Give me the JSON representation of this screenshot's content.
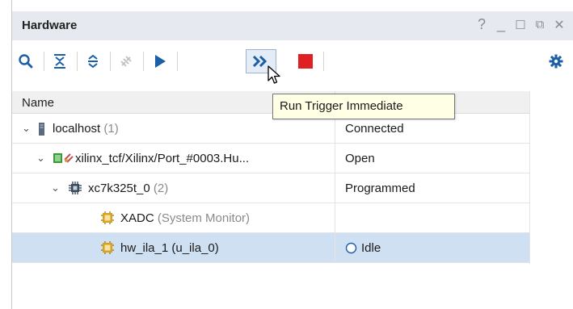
{
  "window": {
    "title": "Hardware",
    "controls": {
      "help": "?",
      "minimize": "_",
      "maximize": "☐",
      "restore": "⧉",
      "close": "✕"
    }
  },
  "toolbar": {
    "buttons": [
      {
        "icon": "search-icon"
      },
      {
        "icon": "collapse-all-icon"
      },
      {
        "icon": "expand-all-icon"
      },
      {
        "icon": "auto-connect-icon"
      },
      {
        "icon": "run-trigger-icon"
      },
      {
        "icon": "run-trigger-immediate-icon"
      },
      {
        "icon": "stop-trigger-icon"
      },
      {
        "icon": "gear-icon"
      }
    ],
    "tooltip": "Run Trigger Immediate"
  },
  "table": {
    "headers": {
      "name": "Name"
    },
    "rows": [
      {
        "label": "localhost",
        "suffix": "(1)",
        "status": "Connected",
        "icon": "server-icon"
      },
      {
        "label": "xilinx_tcf/Xilinx/Port_#0003.Hu...",
        "suffix": "",
        "status": "Open",
        "icon": "jtag-cable-icon"
      },
      {
        "label": "xc7k325t_0",
        "suffix": "(2)",
        "status": "Programmed",
        "icon": "fpga-chip-icon"
      },
      {
        "label": "XADC",
        "suffix": "(System Monitor)",
        "status": "",
        "icon": "xadc-core-icon"
      },
      {
        "label": "hw_ila_1 (u_ila_0)",
        "suffix": "",
        "status": "Idle",
        "icon": "ila-core-icon"
      }
    ]
  },
  "colors": {
    "titlebar": "#e6eaf0",
    "selected_row": "#cfe0f3",
    "run_blue": "#1a5fa8",
    "stop_red": "#e02020",
    "tooltip_bg": "#ffffe6"
  }
}
